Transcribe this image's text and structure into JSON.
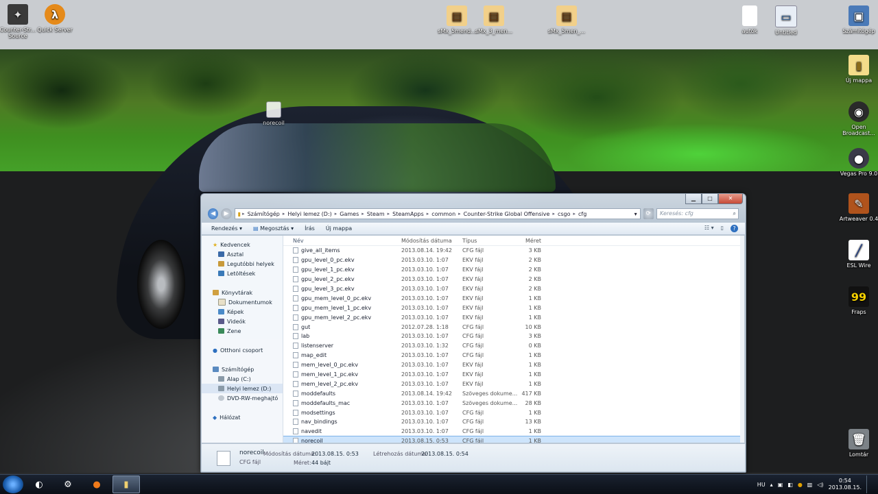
{
  "desktop": {
    "icons_top_left": [
      {
        "label": "Counter-Str... Source",
        "icon": "counter-strike-icon"
      },
      {
        "label": "Quick Server",
        "icon": "half-life-icon"
      }
    ],
    "icons_top_center": [
      {
        "label": "sMx_5mend...",
        "icon": "archive-icon"
      },
      {
        "label": "sMx_3_men...",
        "icon": "archive-icon"
      },
      {
        "label": "sMx_5men_...",
        "icon": "archive-icon"
      }
    ],
    "icons_top_right": [
      {
        "label": "autók",
        "icon": "file-icon"
      },
      {
        "label": "Untitled",
        "icon": "window-icon"
      },
      {
        "label": "Számítógép",
        "icon": "computer-icon"
      }
    ],
    "icons_right": [
      {
        "label": "Új mappa",
        "icon": "folder-icon"
      },
      {
        "label": "Open Broadcast...",
        "icon": "obs-icon"
      },
      {
        "label": "Vegas Pro 9.0",
        "icon": "vegas-icon"
      },
      {
        "label": "Artweaver 0.4",
        "icon": "artweaver-icon"
      },
      {
        "label": "ESL Wire",
        "icon": "esl-icon"
      },
      {
        "label": "Fraps",
        "icon": "fraps-icon"
      },
      {
        "label": "Lomtár",
        "icon": "recycle-bin-icon"
      }
    ],
    "dragging_icon": {
      "label": "norecoil",
      "icon": "file-icon"
    }
  },
  "explorer": {
    "breadcrumb": [
      "Számítógép",
      "Helyi lemez (D:)",
      "Games",
      "Steam",
      "SteamApps",
      "common",
      "Counter-Strike Global Offensive",
      "csgo",
      "cfg"
    ],
    "search_placeholder": "Keresés: cfg",
    "toolbar": {
      "organize": "Rendezés",
      "share": "Megosztás",
      "burn": "Írás",
      "new_folder": "Új mappa"
    },
    "nav": {
      "favorites": {
        "label": "Kedvencek",
        "items": [
          "Asztal",
          "Legutóbbi helyek",
          "Letöltések"
        ]
      },
      "libraries": {
        "label": "Könyvtárak",
        "items": [
          "Dokumentumok",
          "Képek",
          "Videók",
          "Zene"
        ]
      },
      "homegroup": {
        "label": "Otthoni csoport"
      },
      "computer": {
        "label": "Számítógép",
        "items": [
          "Alap (C:)",
          "Helyi lemez (D:)",
          "DVD-RW-meghajtó"
        ]
      },
      "network": {
        "label": "Hálózat"
      },
      "selected_item": "Helyi lemez (D:)"
    },
    "columns": {
      "name": "Név",
      "date": "Módosítás dátuma",
      "type": "Típus",
      "size": "Méret"
    },
    "files": [
      {
        "name": "give_all_items",
        "date": "2013.08.14. 19:42",
        "type": "CFG fájl",
        "size": "3 KB"
      },
      {
        "name": "gpu_level_0_pc.ekv",
        "date": "2013.03.10. 1:07",
        "type": "EKV fájl",
        "size": "2 KB"
      },
      {
        "name": "gpu_level_1_pc.ekv",
        "date": "2013.03.10. 1:07",
        "type": "EKV fájl",
        "size": "2 KB"
      },
      {
        "name": "gpu_level_2_pc.ekv",
        "date": "2013.03.10. 1:07",
        "type": "EKV fájl",
        "size": "2 KB"
      },
      {
        "name": "gpu_level_3_pc.ekv",
        "date": "2013.03.10. 1:07",
        "type": "EKV fájl",
        "size": "2 KB"
      },
      {
        "name": "gpu_mem_level_0_pc.ekv",
        "date": "2013.03.10. 1:07",
        "type": "EKV fájl",
        "size": "1 KB"
      },
      {
        "name": "gpu_mem_level_1_pc.ekv",
        "date": "2013.03.10. 1:07",
        "type": "EKV fájl",
        "size": "1 KB"
      },
      {
        "name": "gpu_mem_level_2_pc.ekv",
        "date": "2013.03.10. 1:07",
        "type": "EKV fájl",
        "size": "1 KB"
      },
      {
        "name": "gut",
        "date": "2012.07.28. 1:18",
        "type": "CFG fájl",
        "size": "10 KB"
      },
      {
        "name": "lab",
        "date": "2013.03.10. 1:07",
        "type": "CFG fájl",
        "size": "3 KB"
      },
      {
        "name": "listenserver",
        "date": "2013.03.10. 1:32",
        "type": "CFG fájl",
        "size": "0 KB"
      },
      {
        "name": "map_edit",
        "date": "2013.03.10. 1:07",
        "type": "CFG fájl",
        "size": "1 KB"
      },
      {
        "name": "mem_level_0_pc.ekv",
        "date": "2013.03.10. 1:07",
        "type": "EKV fájl",
        "size": "1 KB"
      },
      {
        "name": "mem_level_1_pc.ekv",
        "date": "2013.03.10. 1:07",
        "type": "EKV fájl",
        "size": "1 KB"
      },
      {
        "name": "mem_level_2_pc.ekv",
        "date": "2013.03.10. 1:07",
        "type": "EKV fájl",
        "size": "1 KB"
      },
      {
        "name": "moddefaults",
        "date": "2013.08.14. 19:42",
        "type": "Szöveges dokume...",
        "size": "417 KB"
      },
      {
        "name": "moddefaults_mac",
        "date": "2013.03.10. 1:07",
        "type": "Szöveges dokume...",
        "size": "28 KB"
      },
      {
        "name": "modsettings",
        "date": "2013.03.10. 1:07",
        "type": "CFG fájl",
        "size": "1 KB"
      },
      {
        "name": "nav_bindings",
        "date": "2013.03.10. 1:07",
        "type": "CFG fájl",
        "size": "13 KB"
      },
      {
        "name": "navedit",
        "date": "2013.03.10. 1:07",
        "type": "CFG fájl",
        "size": "1 KB"
      },
      {
        "name": "norecoil",
        "date": "2013.08.15. 0:53",
        "type": "CFG fájl",
        "size": "1 KB"
      }
    ],
    "selected_file": "norecoil",
    "details": {
      "name": "norecoil",
      "type": "CFG fájl",
      "modified_label": "Módosítás dátuma:",
      "modified": "2013.08.15. 0:53",
      "created_label": "Létrehozás dátuma:",
      "created": "2013.08.15. 0:54",
      "size_label": "Méret:",
      "size": "44 bájt"
    }
  },
  "taskbar": {
    "language": "HU",
    "time": "0:54",
    "date": "2013.08.15."
  },
  "colors": {
    "accent": "#2d6fbf",
    "selection": "#cde4fb",
    "close_button": "#c64a36"
  }
}
